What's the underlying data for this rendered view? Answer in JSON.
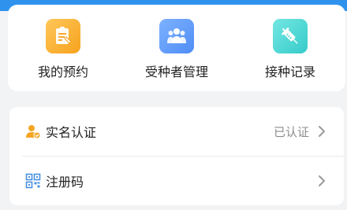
{
  "quick_actions": [
    {
      "label": "我的预约",
      "icon": "clipboard-icon",
      "color": "#f6a21d"
    },
    {
      "label": "受种者管理",
      "icon": "people-group-icon",
      "color": "#4f8df5"
    },
    {
      "label": "接种记录",
      "icon": "syringe-icon",
      "color": "#36cbc9"
    }
  ],
  "list": [
    {
      "title": "实名认证",
      "status": "已认证",
      "icon": "verified-user-icon"
    },
    {
      "title": "注册码",
      "icon": "qr-code-icon"
    }
  ],
  "colors": {
    "accent": "#2f93ee",
    "status_text": "#8c8c8c",
    "chevron": "#9a9a9a"
  }
}
